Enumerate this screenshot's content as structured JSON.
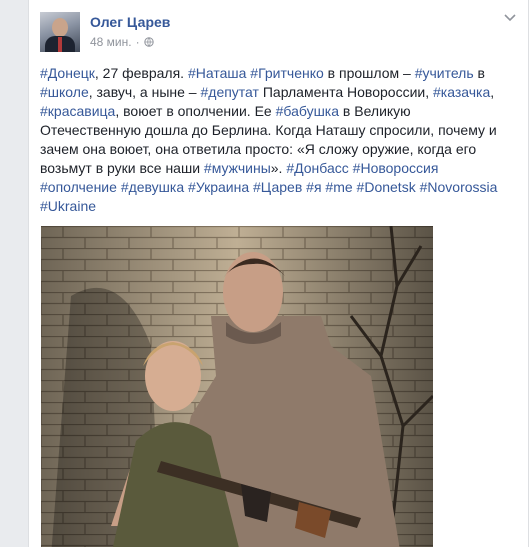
{
  "post": {
    "author": "Олег Царев",
    "time": "48 мин.",
    "separator": "·",
    "privacy_icon": "globe-icon",
    "options_icon": "chevron-down-icon",
    "text": [
      {
        "tag": "#Донецк"
      },
      {
        "t": ", 27 февраля. "
      },
      {
        "tag": "#Наташа"
      },
      {
        "t": " "
      },
      {
        "tag": "#Гритченко"
      },
      {
        "t": " в прошлом – "
      },
      {
        "tag": "#учитель"
      },
      {
        "t": " в "
      },
      {
        "tag": "#школе"
      },
      {
        "t": ", завуч, а ныне – "
      },
      {
        "tag": "#депутат"
      },
      {
        "t": " Парламента Новороссии, "
      },
      {
        "tag": "#казачка"
      },
      {
        "t": ", "
      },
      {
        "tag": "#красавица"
      },
      {
        "t": ", воюет в ополчении. Ее "
      },
      {
        "tag": "#бабушка"
      },
      {
        "t": " в Великую Отечественную дошла до Берлина. Когда Наташу спросили, почему и зачем она воюет, она ответила просто: «Я сложу оружие, когда его возьмут в руки все наши "
      },
      {
        "tag": "#мужчины"
      },
      {
        "t": "». "
      },
      {
        "tag": "#Донбасс"
      },
      {
        "t": " "
      },
      {
        "tag": "#Новороссия"
      },
      {
        "t": " "
      },
      {
        "tag": "#ополчение"
      },
      {
        "t": " "
      },
      {
        "tag": "#девушка"
      },
      {
        "t": " "
      },
      {
        "tag": "#Украина"
      },
      {
        "t": " "
      },
      {
        "tag": "#Царев"
      },
      {
        "t": " "
      },
      {
        "tag": "#я"
      },
      {
        "t": " "
      },
      {
        "tag": "#me"
      },
      {
        "t": " "
      },
      {
        "tag": "#Donetsk"
      },
      {
        "t": " "
      },
      {
        "tag": "#Novorossia"
      },
      {
        "t": " "
      },
      {
        "tag": "#Ukraine"
      }
    ]
  },
  "colors": {
    "link": "#365899",
    "text": "#1d2129",
    "meta": "#90949c",
    "page_bg": "#e9ebee"
  }
}
